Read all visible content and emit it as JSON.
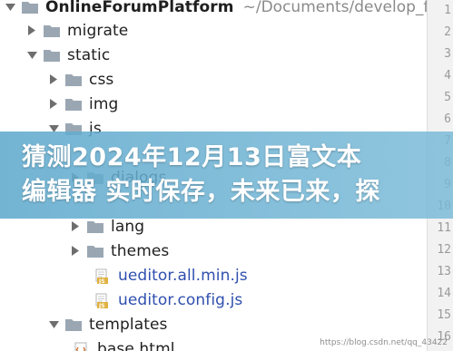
{
  "tree": {
    "root": {
      "name": "OnlineForumPlatform",
      "path": "~/Documents/develop_file"
    },
    "items": [
      {
        "name": "migrate",
        "type": "folder",
        "expanded": false
      },
      {
        "name": "static",
        "type": "folder",
        "expanded": true
      },
      {
        "name": "css",
        "type": "folder",
        "expanded": false
      },
      {
        "name": "img",
        "type": "folder",
        "expanded": false
      },
      {
        "name": "js",
        "type": "folder",
        "expanded": true
      },
      {
        "name": "dialogs",
        "type": "folder",
        "expanded": false
      },
      {
        "name": "lang",
        "type": "folder",
        "expanded": false
      },
      {
        "name": "themes",
        "type": "folder",
        "expanded": false
      },
      {
        "name": "ueditor.all.min.js",
        "type": "js-file"
      },
      {
        "name": "ueditor.config.js",
        "type": "js-file"
      },
      {
        "name": "templates",
        "type": "folder",
        "expanded": true
      },
      {
        "name": "base.html",
        "type": "html-file"
      }
    ]
  },
  "gutter": {
    "line_numbers": [
      "1",
      "2",
      "3",
      "4",
      "5",
      "6",
      "7",
      "8",
      "9",
      "10",
      "11",
      "12",
      "13",
      "14",
      "15",
      "16"
    ]
  },
  "banner": {
    "line1": "猜测2024年12月13日富文本",
    "line2": "编辑器 实时保存，未来已来，探"
  },
  "watermark": "https://blog.csdn.net/qq_43422",
  "colors": {
    "banner": "#6aaed0",
    "folder": "#9aa7b3",
    "js_file_text": "#2f4fae",
    "gutter": "#f2f2f2"
  }
}
